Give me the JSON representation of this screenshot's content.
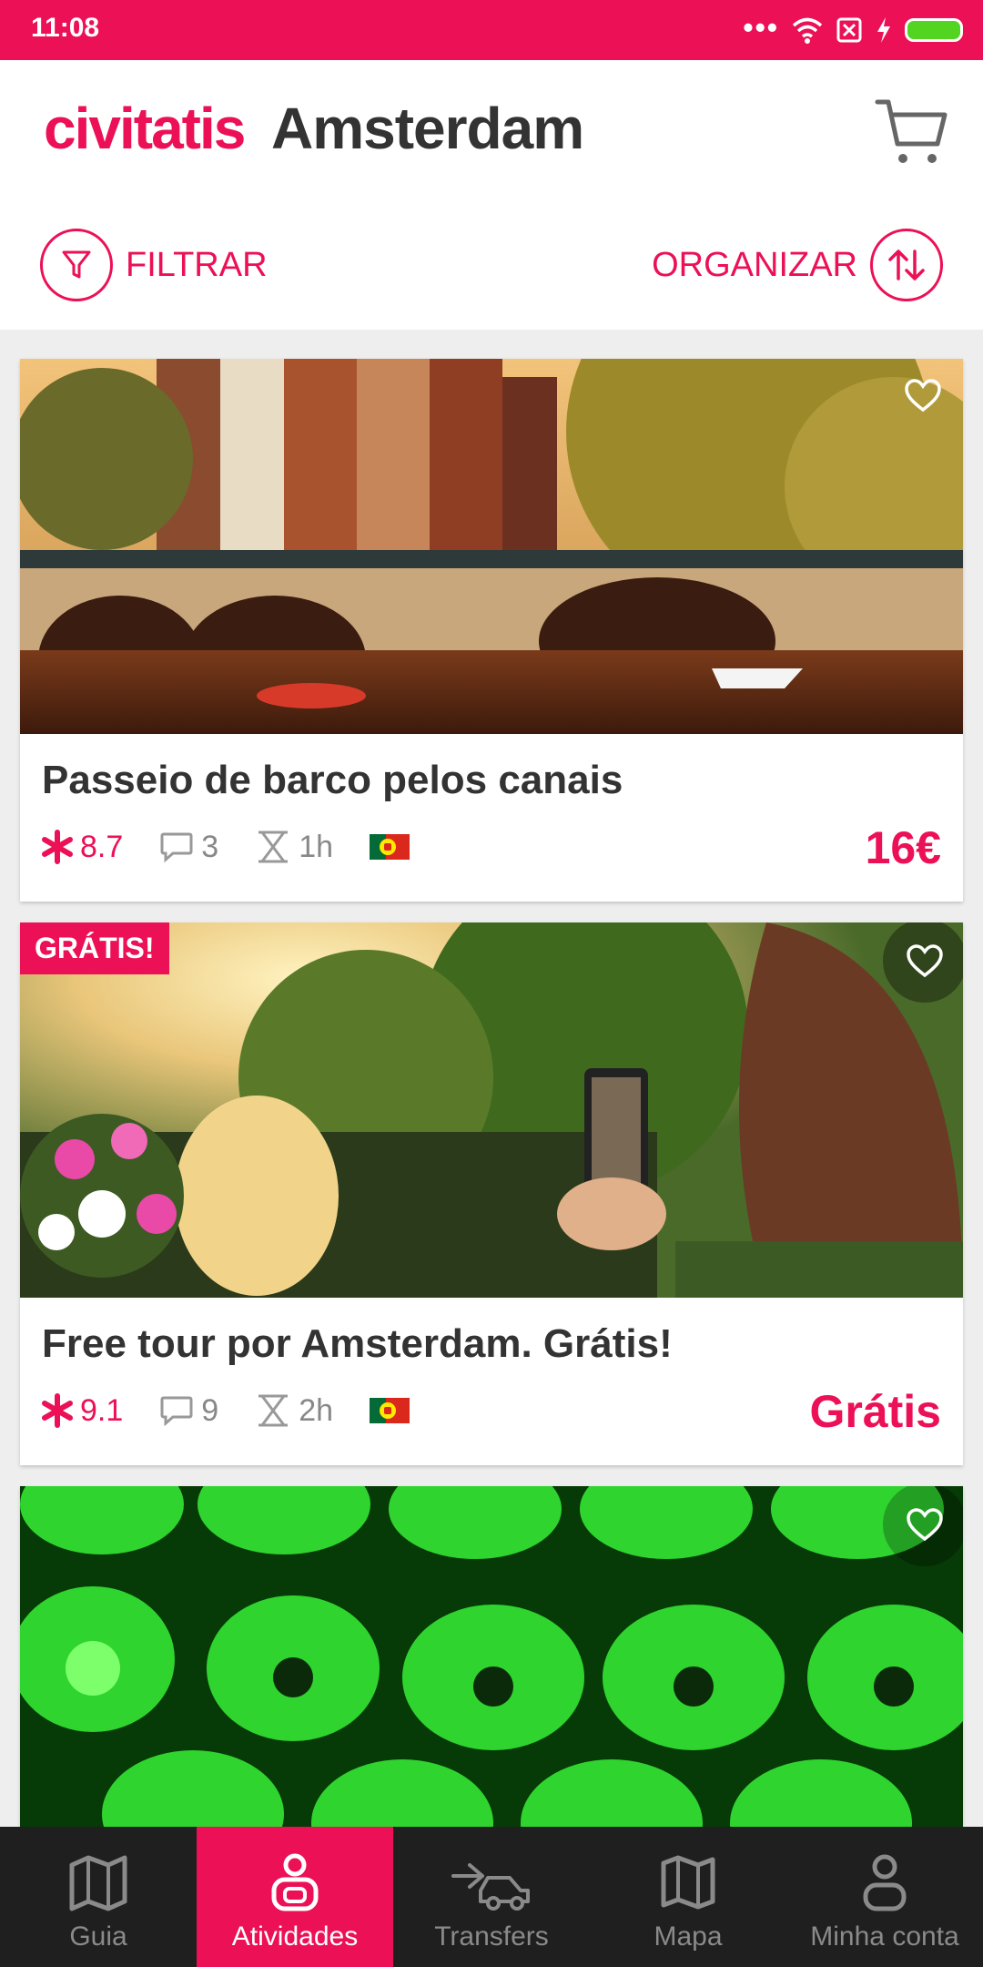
{
  "status": {
    "time": "11:08",
    "dots": "•••"
  },
  "header": {
    "brand": "civitatis",
    "city": "Amsterdam"
  },
  "toolbar": {
    "filter_label": "FILTRAR",
    "sort_label": "ORGANIZAR"
  },
  "cards": [
    {
      "title": "Passeio de barco pelos canais",
      "rating": "8.7",
      "comments": "3",
      "duration": "1h",
      "price": "16€",
      "badge": ""
    },
    {
      "title": "Free tour por Amsterdam. Grátis!",
      "rating": "9.1",
      "comments": "9",
      "duration": "2h",
      "price": "Grátis",
      "badge": "GRÁTIS!"
    },
    {
      "title": "",
      "rating": "",
      "comments": "",
      "duration": "",
      "price": "",
      "badge": ""
    }
  ],
  "nav": [
    {
      "label": "Guia",
      "icon": "map-book-icon",
      "active": false
    },
    {
      "label": "Atividades",
      "icon": "activities-icon",
      "active": true
    },
    {
      "label": "Transfers",
      "icon": "car-icon",
      "active": false
    },
    {
      "label": "Mapa",
      "icon": "map-icon",
      "active": false
    },
    {
      "label": "Minha conta",
      "icon": "user-icon",
      "active": false
    }
  ],
  "colors": {
    "accent": "#ec1056",
    "nav_bg": "#1f1f1f"
  }
}
